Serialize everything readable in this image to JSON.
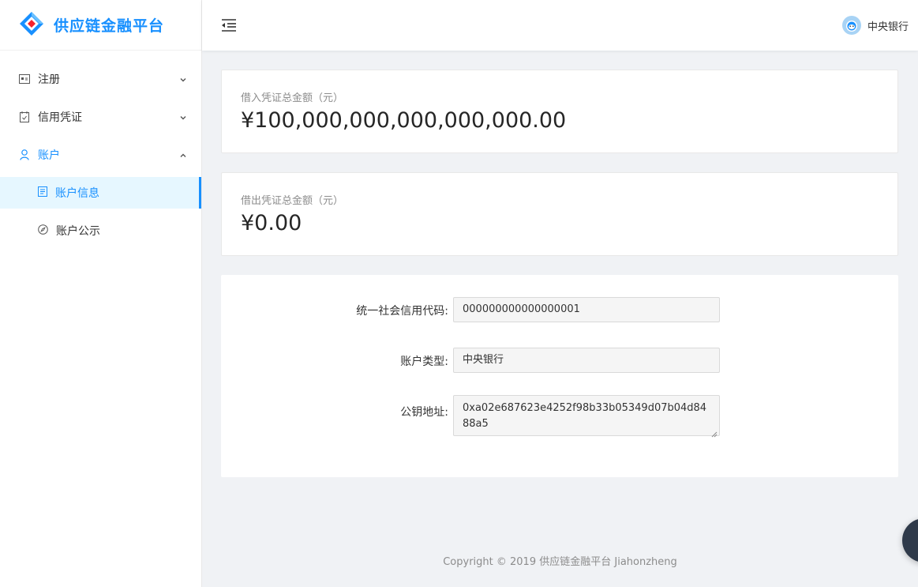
{
  "app": {
    "title": "供应链金融平台",
    "brand_color": "#1890ff"
  },
  "sidebar": {
    "items": [
      {
        "label": "注册",
        "icon": "id-card-icon",
        "expanded": false
      },
      {
        "label": "信用凭证",
        "icon": "calendar-check-icon",
        "expanded": false
      },
      {
        "label": "账户",
        "icon": "user-icon",
        "expanded": true,
        "children": [
          {
            "label": "账户信息",
            "icon": "profile-icon",
            "active": true
          },
          {
            "label": "账户公示",
            "icon": "compass-icon",
            "active": false
          }
        ]
      }
    ]
  },
  "header": {
    "user_name": "中央银行"
  },
  "stats": [
    {
      "title": "借入凭证总金额（元）",
      "value": "¥100,000,000,000,000,000.00"
    },
    {
      "title": "借出凭证总金额（元）",
      "value": "¥0.00"
    }
  ],
  "form": {
    "credit_code": {
      "label": "统一社会信用代码:",
      "value": "000000000000000001"
    },
    "account_type": {
      "label": "账户类型:",
      "value": "中央银行"
    },
    "public_key": {
      "label": "公钥地址:",
      "value": "0xa02e687623e4252f98b33b05349d07b04d8488a5"
    }
  },
  "footer": {
    "text": "Copyright © 2019 供应链金融平台 Jiahonzheng"
  }
}
